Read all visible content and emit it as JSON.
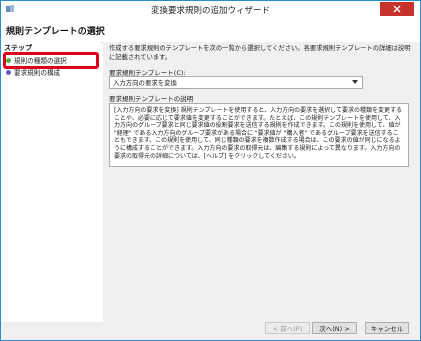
{
  "window": {
    "title": "変換要求規則の追加ウィザード",
    "close_label": "×"
  },
  "header": {
    "title": "規則テンプレートの選択"
  },
  "sidebar": {
    "heading": "ステップ",
    "items": [
      {
        "label": "規則の種類の選択",
        "state": "current",
        "color": "#4caf50"
      },
      {
        "label": "要求規則の構成",
        "state": "pending",
        "color": "#6a5acd"
      }
    ]
  },
  "main": {
    "instructions": "作成する要求規則のテンプレートを次の一覧から選択してください。各要求規則テンプレートの詳細は説明に記載されています。",
    "template_label": "要求規則テンプレート(C):",
    "template_value": "入力方向の要求を変換",
    "description_label": "要求規則テンプレートの説明",
    "description": "[入力方向の要求を変換] 規則テンプレートを使用すると、入力方向の要求を選択して要求の種類を変更することや、必要に応じて要求値を変更することができます。たとえば、この規則テンプレートを使用して、入力方向のグループ要求と同じ要求値の役割要求を送信する規則を作成できます。この規則を使用して、値が \"経理\" である入力方向のグループ要求がある場合に \"要求値が \"購入者\" であるグループ要求を送信することもできます。この規則を使用して、同じ種類の要求を複数作成する場合は、この要求の値が同じになるように構成することができます。入力方向の要求の取得元は、編集する規則によって異なります。入力方向の要求の取得元の詳細については、[ヘルプ] をクリックしてください。"
  },
  "footer": {
    "back_label": "< 前へ(P)",
    "next_label": "次へ(N) >",
    "cancel_label": "キャンセル"
  },
  "colors": {
    "highlight": "#e0001b",
    "close": "#c7312b",
    "border": "#2a8dd4"
  }
}
